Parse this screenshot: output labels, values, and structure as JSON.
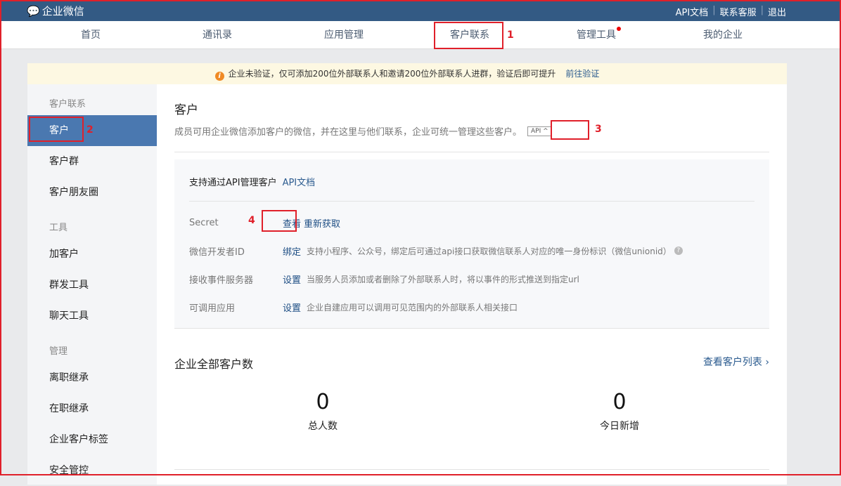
{
  "topbar": {
    "logo": "企业微信",
    "links": [
      "API文档",
      "联系客服",
      "退出"
    ]
  },
  "nav": {
    "items": [
      "首页",
      "通讯录",
      "应用管理",
      "客户联系",
      "管理工具",
      "我的企业"
    ]
  },
  "notice": {
    "text": "企业未验证，仅可添加200位外部联系人和邀请200位外部联系人进群，验证后即可提升",
    "link": "前往验证"
  },
  "sidebar": {
    "groups": [
      {
        "title": "客户联系",
        "items": [
          "客户",
          "客户群",
          "客户朋友圈"
        ]
      },
      {
        "title": "工具",
        "items": [
          "加客户",
          "群发工具",
          "聊天工具"
        ]
      },
      {
        "title": "管理",
        "items": [
          "离职继承",
          "在职继承",
          "企业客户标签",
          "安全管控"
        ]
      }
    ]
  },
  "main": {
    "title": "客户",
    "desc": "成员可用企业微信添加客户的微信，并在这里与他们联系，企业可统一管理这些客户。",
    "api_badge": "API ^",
    "api_panel": {
      "title": "支持通过API管理客户",
      "doc_link": "API文档",
      "rows": [
        {
          "key": "Secret",
          "action": "查看",
          "action2": "重新获取",
          "desc": ""
        },
        {
          "key": "微信开发者ID",
          "action": "绑定",
          "desc": "支持小程序、公众号，绑定后可通过api接口获取微信联系人对应的唯一身份标识（微信unionid）"
        },
        {
          "key": "接收事件服务器",
          "action": "设置",
          "desc": "当服务人员添加或者删除了外部联系人时，将以事件的形式推送到指定url"
        },
        {
          "key": "可调用应用",
          "action": "设置",
          "desc": "企业自建应用可以调用可见范围内的外部联系人相关接口"
        }
      ]
    },
    "summary": {
      "title": "企业全部客户数",
      "link": "查看客户列表 ›",
      "stats": [
        {
          "value": "0",
          "label": "总人数"
        },
        {
          "value": "0",
          "label": "今日新增"
        }
      ]
    }
  },
  "annotations": [
    "1",
    "2",
    "3",
    "4"
  ]
}
